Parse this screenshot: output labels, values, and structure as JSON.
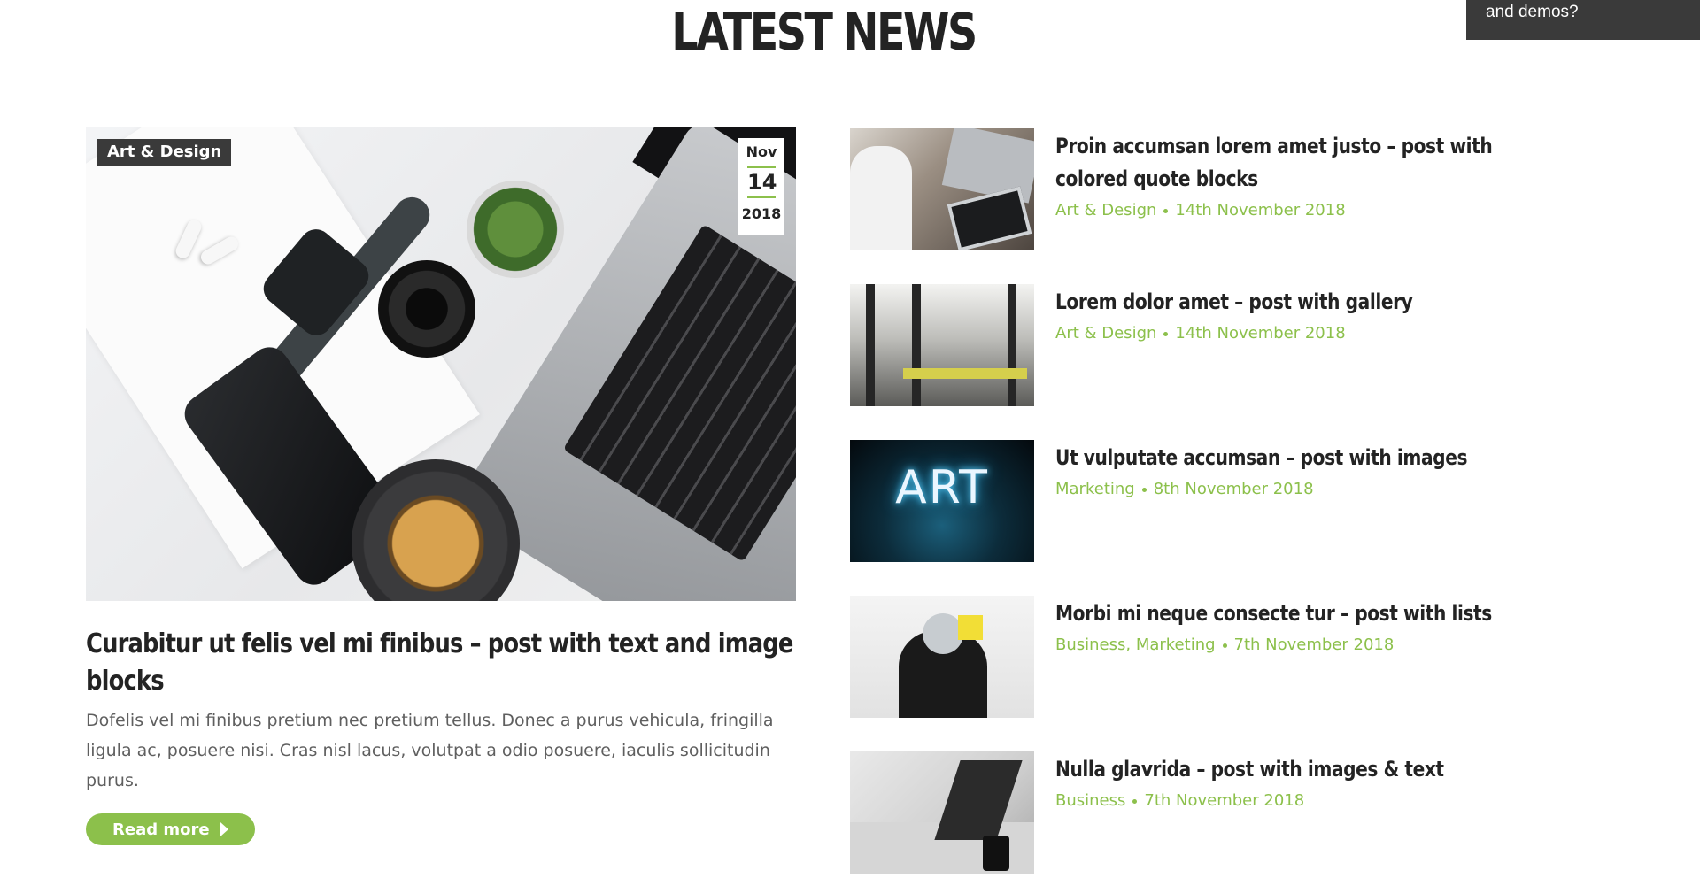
{
  "section": {
    "title": "LATEST NEWS"
  },
  "promo": {
    "text": "and demos?"
  },
  "featured": {
    "category": "Art & Design",
    "date": {
      "month": "Nov",
      "day": "14",
      "year": "2018"
    },
    "title": "Curabitur ut felis vel mi finibus – post with text and image blocks",
    "excerpt": "Dofelis vel mi finibus pretium nec pretium tellus. Donec a purus vehicula, fringilla ligula ac, posuere nisi. Cras nisl lacus, volutpat a odio posuere, iaculis sollicitudin purus.",
    "read_more": "Read more"
  },
  "posts": [
    {
      "title": "Proin accumsan lorem amet justo – post with colored quote blocks",
      "category": "Art & Design",
      "date": "14th November 2018"
    },
    {
      "title": "Lorem dolor amet – post with gallery",
      "category": "Art & Design",
      "date": "14th November 2018"
    },
    {
      "title": "Ut vulputate accumsan – post with images",
      "category": "Marketing",
      "date": "8th November 2018",
      "thumb_text": "ART"
    },
    {
      "title": "Morbi mi neque consecte tur – post with lists",
      "category": "Business, Marketing",
      "date": "7th November 2018"
    },
    {
      "title": "Nulla glavrida – post with images & text",
      "category": "Business",
      "date": "7th November 2018"
    }
  ],
  "colors": {
    "accent": "#8cc04b",
    "dark": "#3a3a3a",
    "text": "#232323",
    "muted": "#5f5f5f"
  }
}
